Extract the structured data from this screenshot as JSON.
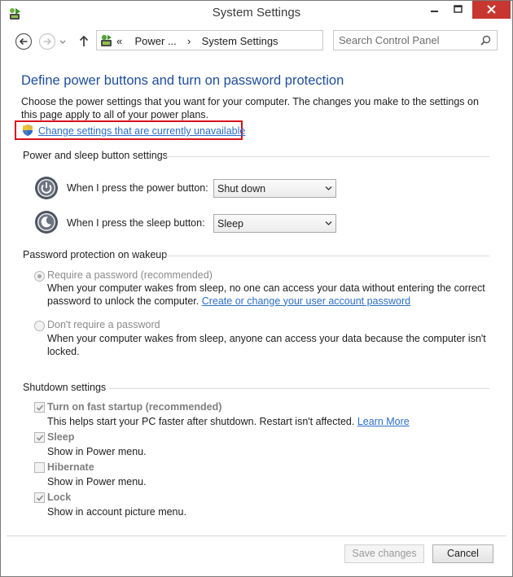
{
  "window": {
    "title": "System Settings"
  },
  "navigation": {
    "back_icon": "back-arrow-icon",
    "forward_icon": "forward-arrow-icon",
    "up_icon": "up-arrow-icon",
    "breadcrumb_overflow": "«",
    "breadcrumb_parent": "Power ...",
    "breadcrumb_separator": "›",
    "breadcrumb_current": "System Settings",
    "search_placeholder": "Search Control Panel"
  },
  "page": {
    "heading": "Define power buttons and turn on password protection",
    "intro": "Choose the power settings that you want for your computer. The changes you make to the settings on this page apply to all of your power plans.",
    "unlock_link": "Change settings that are currently unavailable",
    "highlight_color": "#d9111c"
  },
  "power_buttons": {
    "group_label": "Power and sleep button settings",
    "rows": [
      {
        "label": "When I press the power button:",
        "value": "Shut down"
      },
      {
        "label": "When I press the sleep button:",
        "value": "Sleep"
      }
    ]
  },
  "password": {
    "group_label": "Password protection on wakeup",
    "options": [
      {
        "label": "Require a password (recommended)",
        "selected": true,
        "description": "When your computer wakes from sleep, no one can access your data without entering the correct password to unlock the computer.",
        "link": "Create or change your user account password"
      },
      {
        "label": "Don't require a password",
        "selected": false,
        "description": "When your computer wakes from sleep, anyone can access your data because the computer isn't locked."
      }
    ]
  },
  "shutdown": {
    "group_label": "Shutdown settings",
    "items": [
      {
        "label": "Turn on fast startup (recommended)",
        "checked": true,
        "description": "This helps start your PC faster after shutdown. Restart isn't affected.",
        "link": "Learn More"
      },
      {
        "label": "Sleep",
        "checked": true,
        "description": "Show in Power menu."
      },
      {
        "label": "Hibernate",
        "checked": false,
        "description": "Show in Power menu."
      },
      {
        "label": "Lock",
        "checked": true,
        "description": "Show in account picture menu."
      }
    ]
  },
  "footer": {
    "save_label": "Save changes",
    "cancel_label": "Cancel"
  },
  "colors": {
    "heading": "#1e4e9a",
    "link": "#2a6ec9",
    "close_button": "#c7372f"
  }
}
